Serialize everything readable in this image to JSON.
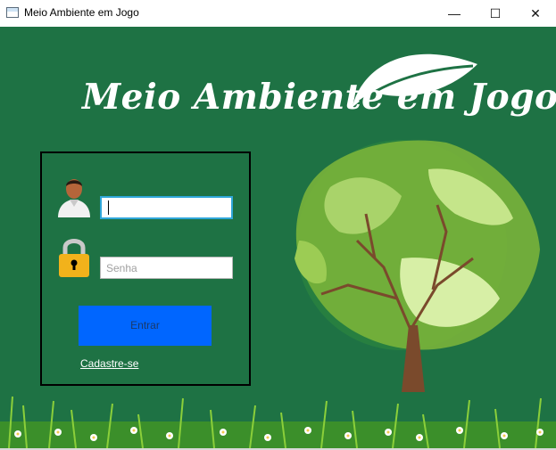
{
  "window": {
    "title": "Meio Ambiente em Jogo",
    "minimize_glyph": "—",
    "maximize_glyph": "☐",
    "close_glyph": "✕"
  },
  "banner": {
    "title": "Meio Ambiente em Jogo"
  },
  "login": {
    "username_value": "",
    "password_placeholder": "Senha",
    "submit_label": "Entrar",
    "signup_link": "Cadastre-se"
  },
  "colors": {
    "background": "#1e7244",
    "button": "#0066ff",
    "input_focus_border": "#2fa7d9",
    "panel_border": "#000000"
  },
  "icons": [
    "app-window-icon",
    "user-avatar-icon",
    "padlock-icon",
    "leaf-logo-icon",
    "globe-tree-illustration",
    "flower-grass-decoration"
  ]
}
